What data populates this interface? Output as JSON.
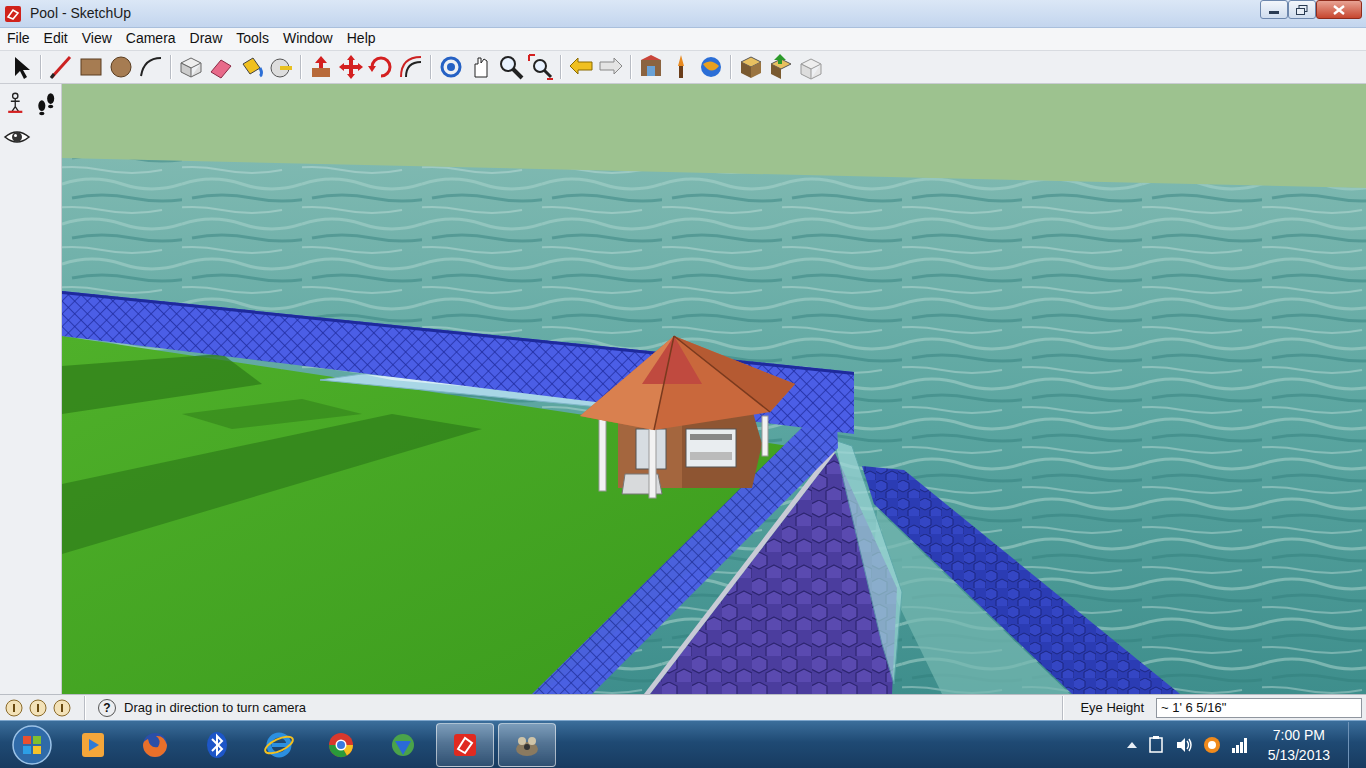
{
  "window": {
    "title": "Pool - SketchUp"
  },
  "menu": [
    "File",
    "Edit",
    "View",
    "Camera",
    "Draw",
    "Tools",
    "Window",
    "Help"
  ],
  "status_bar": {
    "help": "?",
    "message": "Drag in direction to turn camera",
    "measure_label": "Eye Height",
    "measure_value": "~ 1' 6 5/16\""
  },
  "taskbar": {
    "apps": [
      {
        "running": false
      },
      {
        "running": false
      },
      {
        "running": false
      },
      {
        "running": false
      },
      {
        "running": false
      },
      {
        "running": false
      },
      {
        "running": true
      },
      {
        "running": true
      }
    ],
    "time": "7:00 PM",
    "date": "5/13/2013"
  }
}
